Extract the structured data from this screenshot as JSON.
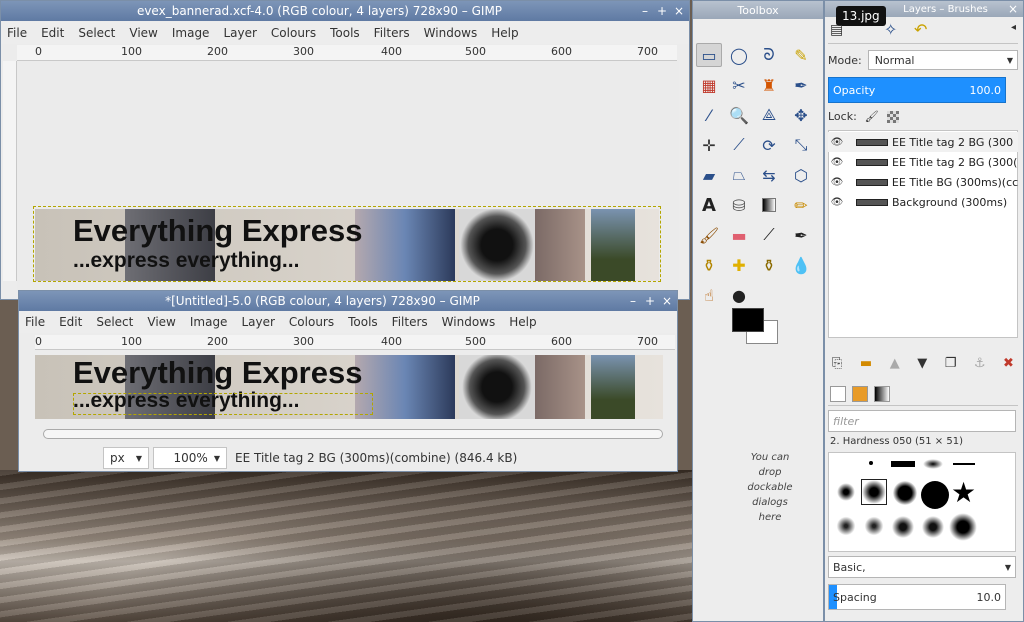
{
  "window_top": {
    "title": "evex_bannerad.xcf-4.0 (RGB colour, 4 layers) 728x90 – GIMP",
    "controls": [
      "–",
      "+",
      "×"
    ]
  },
  "window_bottom": {
    "title": "*[Untitled]-5.0 (RGB colour, 4 layers) 728x90 – GIMP",
    "controls": [
      "–",
      "+",
      "×"
    ]
  },
  "menu": [
    "File",
    "Edit",
    "Select",
    "View",
    "Image",
    "Layer",
    "Colours",
    "Tools",
    "Filters",
    "Windows",
    "Help"
  ],
  "ruler_ticks": [
    "0",
    "100",
    "200",
    "300",
    "400",
    "500",
    "600",
    "700"
  ],
  "vruler_top": [
    "0",
    "1\n0\n0",
    "0"
  ],
  "banner": {
    "title": "Everything Express",
    "subtitle": "...express everything..."
  },
  "statusbar": {
    "unit": "px",
    "zoom": "100%",
    "info": "EE Title  tag 2 BG (300ms)(combine) (846.4 kB)"
  },
  "toolbox": {
    "title": "Toolbox",
    "tools": [
      "rect-select",
      "ellipse-select",
      "free-select",
      "fuzzy-select",
      "by-color-select",
      "scissors",
      "foreground-select",
      "paths",
      "color-picker",
      "zoom",
      "measure",
      "move",
      "align",
      "crop",
      "rotate",
      "scale",
      "shear",
      "perspective",
      "flip",
      "cage",
      "text",
      "bucket-fill",
      "blend",
      "pencil",
      "paintbrush",
      "eraser",
      "airbrush",
      "ink",
      "clone",
      "heal",
      "perspective-clone",
      "blur",
      "smudge",
      "dodge"
    ],
    "dock_hint": "You can drop dockable dialogs here"
  },
  "tooltip": "13.jpg",
  "layers_panel": {
    "title": "Layers – Brushes",
    "mode_label": "Mode:",
    "mode_value": "Normal",
    "opacity_label": "Opacity",
    "opacity_value": "100.0",
    "lock_label": "Lock:",
    "layers": [
      {
        "name": "EE Title tag 2 BG (300"
      },
      {
        "name": "EE Title tag 2 BG (300("
      },
      {
        "name": "EE Title BG (300ms)(cc"
      },
      {
        "name": "Background (300ms)"
      }
    ]
  },
  "brushes_panel": {
    "filter_placeholder": "filter",
    "brush_label": "2. Hardness 050 (51 × 51)",
    "preset": "Basic,",
    "spacing_label": "Spacing",
    "spacing_value": "10.0"
  },
  "colors": {
    "accent": "#1e90ff",
    "titlebar": "#6a84ad",
    "fg": "#000000",
    "bg": "#ffffff"
  }
}
